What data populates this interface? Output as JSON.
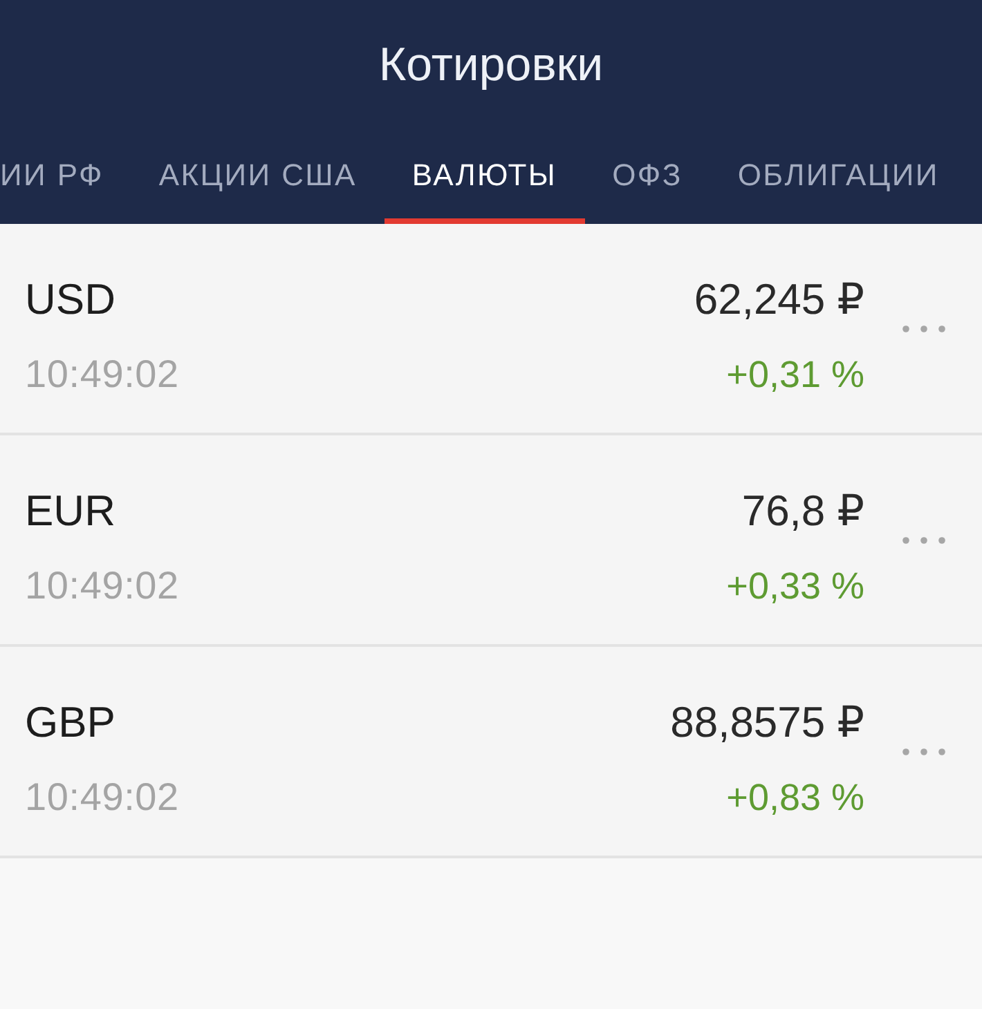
{
  "header": {
    "title": "Котировки"
  },
  "tabs": [
    {
      "label": "ИИ РФ",
      "selected": false
    },
    {
      "label": "АКЦИИ США",
      "selected": false
    },
    {
      "label": "ВАЛЮТЫ",
      "selected": true
    },
    {
      "label": "ОФЗ",
      "selected": false
    },
    {
      "label": "ОБЛИГАЦИИ",
      "selected": false
    }
  ],
  "quotes": [
    {
      "code": "USD",
      "time": "10:49:02",
      "price": "62,245 ₽",
      "change": "+0,31 %"
    },
    {
      "code": "EUR",
      "time": "10:49:02",
      "price": "76,8 ₽",
      "change": "+0,33 %"
    },
    {
      "code": "GBP",
      "time": "10:49:02",
      "price": "88,8575 ₽",
      "change": "+0,83 %"
    }
  ]
}
